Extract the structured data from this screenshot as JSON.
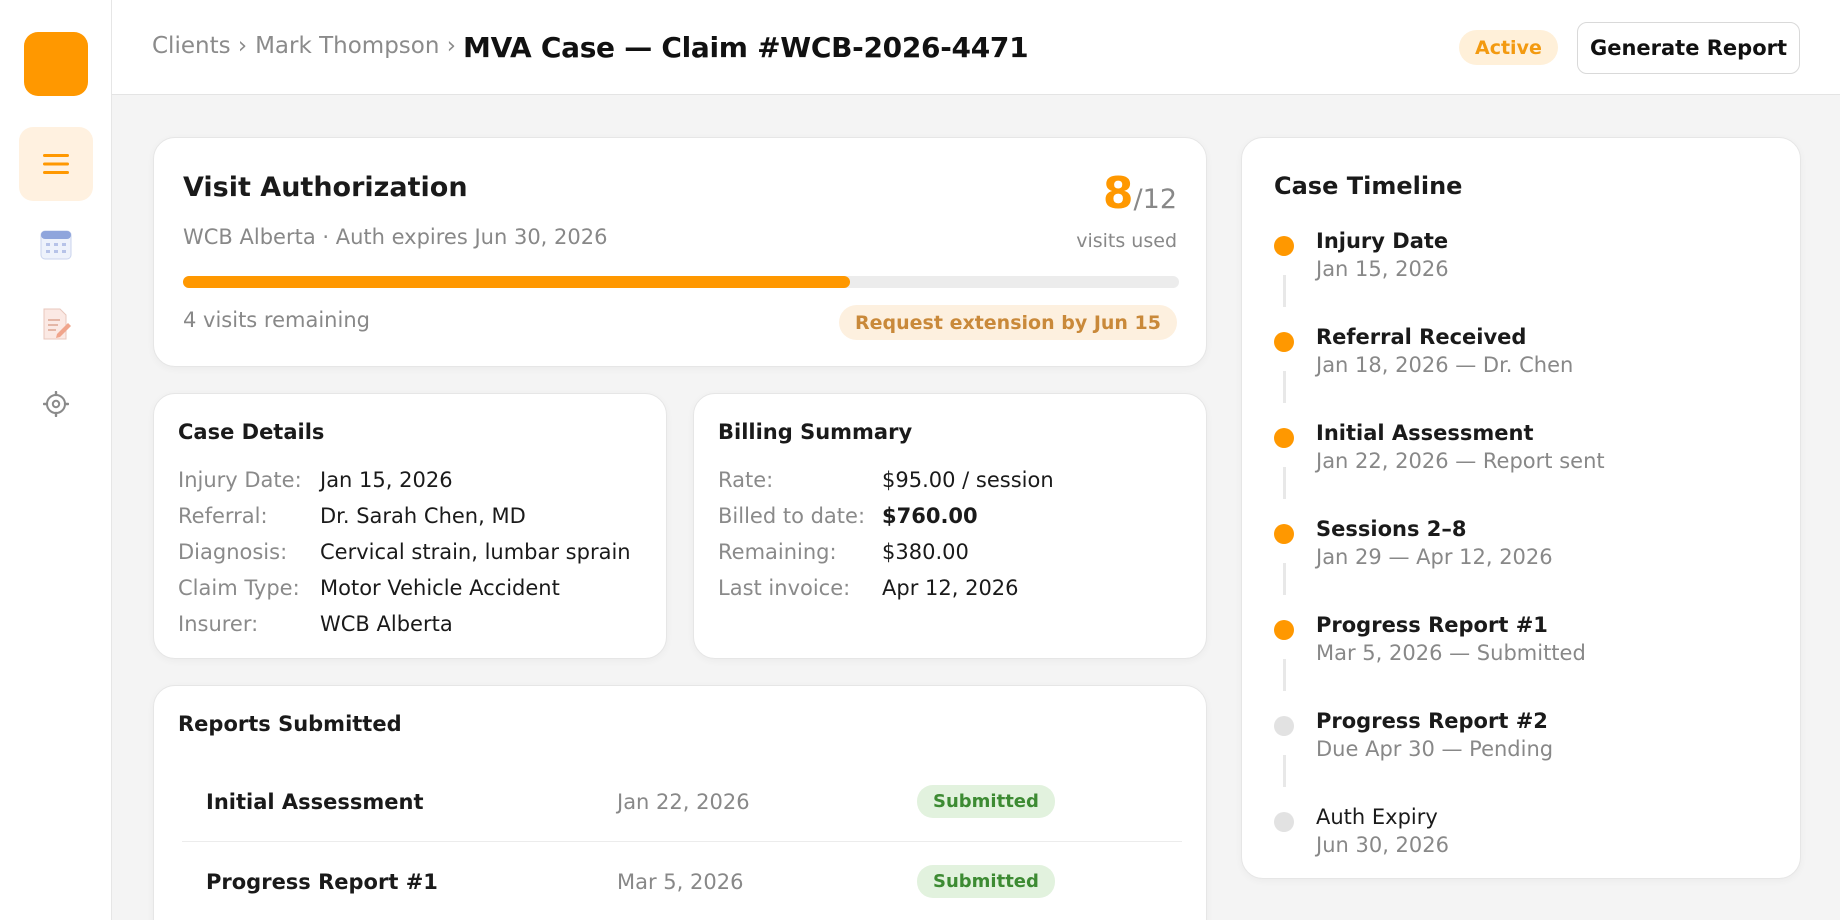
{
  "colors": {
    "accent": "#ff9800",
    "success": "#3d8b33",
    "active_badge": "#f39a10"
  },
  "sidebar": {
    "logo": "app-logo",
    "items": [
      {
        "icon": "menu-icon",
        "active": true
      },
      {
        "icon": "calendar-icon",
        "active": false
      },
      {
        "icon": "document-edit-icon",
        "active": false
      },
      {
        "icon": "gear-icon",
        "active": false
      }
    ]
  },
  "header": {
    "breadcrumb": {
      "clients": "Clients ›",
      "client": "Mark Thompson ›"
    },
    "title": "MVA Case — Claim #WCB-2026-4471",
    "status": "Active",
    "generate_button": "Generate Report"
  },
  "authorization": {
    "title": "Visit Authorization",
    "subtitle": "WCB Alberta · Auth expires Jun 30, 2026",
    "used": "8",
    "total": "/12",
    "used_label": "visits used",
    "progress": 0.67,
    "remaining": "4 visits remaining",
    "extension": "Request extension by Jun 15"
  },
  "details": {
    "title": "Case Details",
    "rows": [
      {
        "k": "Injury Date:",
        "v": "Jan 15, 2026"
      },
      {
        "k": "Referral:",
        "v": "Dr. Sarah Chen, MD"
      },
      {
        "k": "Diagnosis:",
        "v": "Cervical strain, lumbar sprain"
      },
      {
        "k": "Claim Type:",
        "v": "Motor Vehicle Accident"
      },
      {
        "k": "Insurer:",
        "v": "WCB Alberta"
      }
    ]
  },
  "billing": {
    "title": "Billing Summary",
    "rows": [
      {
        "k": "Rate:",
        "v": "$95.00 / session"
      },
      {
        "k": "Billed to date:",
        "v": "$760.00"
      },
      {
        "k": "Remaining:",
        "v": "$380.00"
      },
      {
        "k": "Last invoice:",
        "v": "Apr 12, 2026"
      }
    ]
  },
  "reports": {
    "title": "Reports Submitted",
    "rows": [
      {
        "name": "Initial Assessment",
        "date": "Jan 22, 2026",
        "status": "Submitted"
      },
      {
        "name": "Progress Report #1",
        "date": "Mar 5, 2026",
        "status": "Submitted"
      }
    ]
  },
  "timeline": {
    "title": "Case Timeline",
    "items": [
      {
        "label": "Injury Date",
        "sub": "Jan 15, 2026",
        "done": true
      },
      {
        "label": "Referral Received",
        "sub": "Jan 18, 2026 — Dr. Chen",
        "done": true
      },
      {
        "label": "Initial Assessment",
        "sub": "Jan 22, 2026 — Report sent",
        "done": true
      },
      {
        "label": "Sessions 2–8",
        "sub": "Jan 29 — Apr 12, 2026",
        "done": true
      },
      {
        "label": "Progress Report #1",
        "sub": "Mar 5, 2026 — Submitted",
        "done": true
      },
      {
        "label": "Progress Report #2",
        "sub": "Due Apr 30 — Pending",
        "done": false
      },
      {
        "label": "Auth Expiry",
        "sub": "Jun 30, 2026",
        "done": false
      }
    ]
  }
}
